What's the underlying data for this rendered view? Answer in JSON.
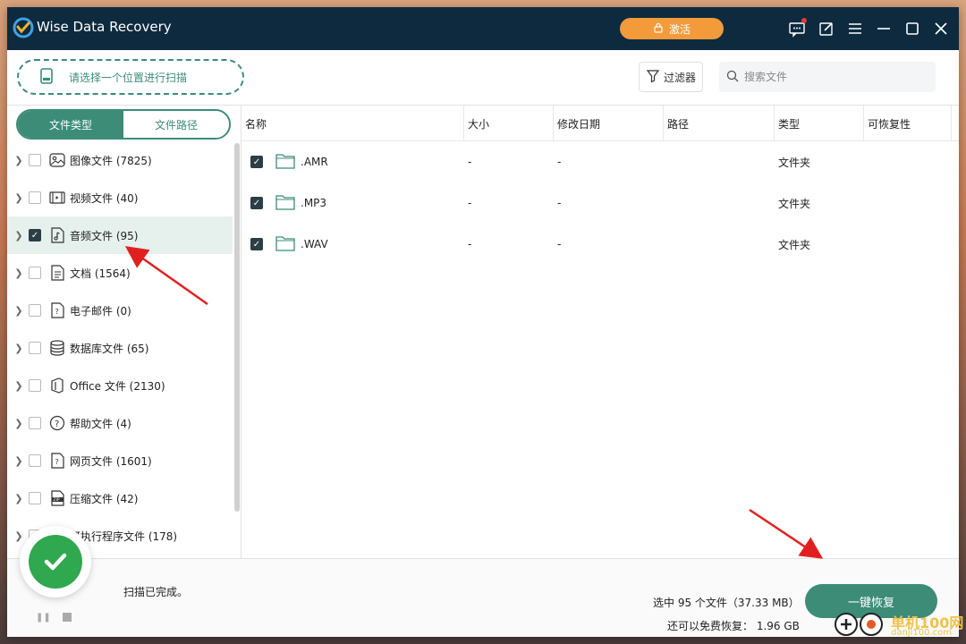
{
  "app": {
    "title": "Wise Data Recovery",
    "activate_label": "激活"
  },
  "toolbar": {
    "location_label": "请选择一个位置进行扫描",
    "filter_label": "过滤器",
    "search_placeholder": "搜索文件"
  },
  "sidebar": {
    "tabs": [
      {
        "label": "文件类型",
        "active": true
      },
      {
        "label": "文件路径",
        "active": false
      }
    ],
    "items": [
      {
        "label": "图像文件 (7825)",
        "icon": "image-icon",
        "checked": false
      },
      {
        "label": "视频文件 (40)",
        "icon": "video-icon",
        "checked": false
      },
      {
        "label": "音频文件 (95)",
        "icon": "audio-icon",
        "checked": true
      },
      {
        "label": "文档 (1564)",
        "icon": "document-icon",
        "checked": false
      },
      {
        "label": "电子邮件 (0)",
        "icon": "email-icon",
        "checked": false
      },
      {
        "label": "数据库文件 (65)",
        "icon": "database-icon",
        "checked": false
      },
      {
        "label": "Office 文件 (2130)",
        "icon": "office-icon",
        "checked": false
      },
      {
        "label": "帮助文件 (4)",
        "icon": "help-icon",
        "checked": false
      },
      {
        "label": "网页文件 (1601)",
        "icon": "web-icon",
        "checked": false
      },
      {
        "label": "压缩文件 (42)",
        "icon": "zip-icon",
        "checked": false
      },
      {
        "label": "可执行程序文件 (178)",
        "icon": "executable-icon",
        "checked": false
      }
    ]
  },
  "table": {
    "columns": [
      "名称",
      "大小",
      "修改日期",
      "路径",
      "类型",
      "可恢复性"
    ],
    "rows": [
      {
        "name": ".AMR",
        "size": "-",
        "modified": "-",
        "path": "",
        "type": "文件夹",
        "recoverability": "",
        "checked": true
      },
      {
        "name": ".MP3",
        "size": "-",
        "modified": "-",
        "path": "",
        "type": "文件夹",
        "recoverability": "",
        "checked": true
      },
      {
        "name": ".WAV",
        "size": "-",
        "modified": "-",
        "path": "",
        "type": "文件夹",
        "recoverability": "",
        "checked": true
      }
    ]
  },
  "footer": {
    "status": "扫描已完成。",
    "selected_info": "选中 95 个文件（37.33 MB）",
    "free_info": "还可以免费恢复：  1.96 GB",
    "recover_label": "一键恢复"
  },
  "watermark": {
    "text": "单机100网",
    "sub": "danji100.com"
  },
  "colors": {
    "accent": "#3c8c78",
    "titlebar": "#0e2a3e",
    "activate": "#f39a3b",
    "annotation": "#e02020"
  }
}
